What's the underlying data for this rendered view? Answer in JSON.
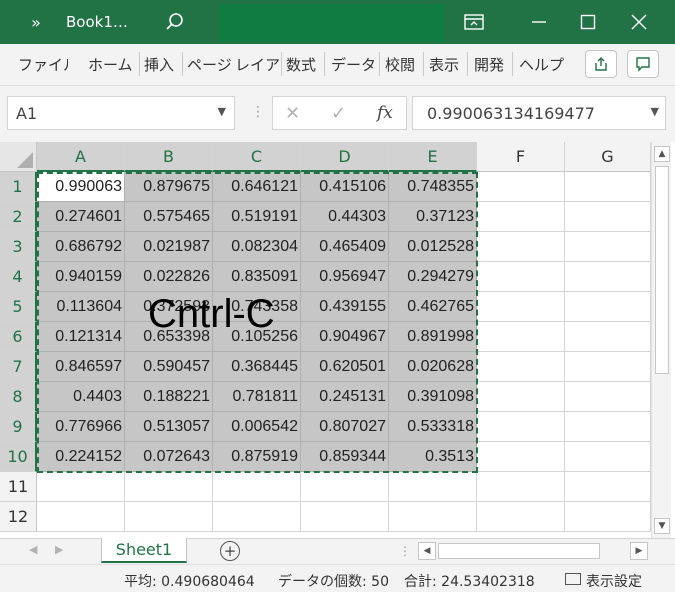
{
  "titlebar": {
    "more": "»",
    "title": "Book1…",
    "brand_color": "#217346"
  },
  "ribbon": {
    "tabs": [
      "ファイル",
      "ホーム",
      "挿入",
      "ページ",
      "レイアウ",
      "数式",
      "データ",
      "校閲",
      "表示",
      "開発",
      "ヘルプ"
    ]
  },
  "formula_bar": {
    "name_box": "A1",
    "fx": "fx",
    "value": "0.990063134169477"
  },
  "grid": {
    "columns": [
      "A",
      "B",
      "C",
      "D",
      "E",
      "F",
      "G"
    ],
    "rows": [
      "1",
      "2",
      "3",
      "4",
      "5",
      "6",
      "7",
      "8",
      "9",
      "10",
      "11",
      "12"
    ],
    "cells": [
      [
        "0.990063",
        "0.879675",
        "0.646121",
        "0.415106",
        "0.748355"
      ],
      [
        "0.274601",
        "0.575465",
        "0.519191",
        "0.44303",
        "0.37123"
      ],
      [
        "0.686792",
        "0.021987",
        "0.082304",
        "0.465409",
        "0.012528"
      ],
      [
        "0.940159",
        "0.022826",
        "0.835091",
        "0.956947",
        "0.294279"
      ],
      [
        "0.113604",
        "0.372593",
        "0.743358",
        "0.439155",
        "0.462765"
      ],
      [
        "0.121314",
        "0.653398",
        "0.105256",
        "0.904967",
        "0.891998"
      ],
      [
        "0.846597",
        "0.590457",
        "0.368445",
        "0.620501",
        "0.020628"
      ],
      [
        "0.4403",
        "0.188221",
        "0.781811",
        "0.245131",
        "0.391098"
      ],
      [
        "0.776966",
        "0.513057",
        "0.006542",
        "0.807027",
        "0.533318"
      ],
      [
        "0.224152",
        "0.072643",
        "0.875919",
        "0.859344",
        "0.3513"
      ]
    ],
    "overlay_text": "Cntrl-C",
    "selection_color": "#217346"
  },
  "sheets": {
    "tabs": [
      "Sheet1"
    ],
    "add": "+"
  },
  "status": {
    "average": "平均: 0.490680464",
    "count": "データの個数: 50",
    "sum": "合計: 24.53402318",
    "display_settings": "表示設定"
  }
}
